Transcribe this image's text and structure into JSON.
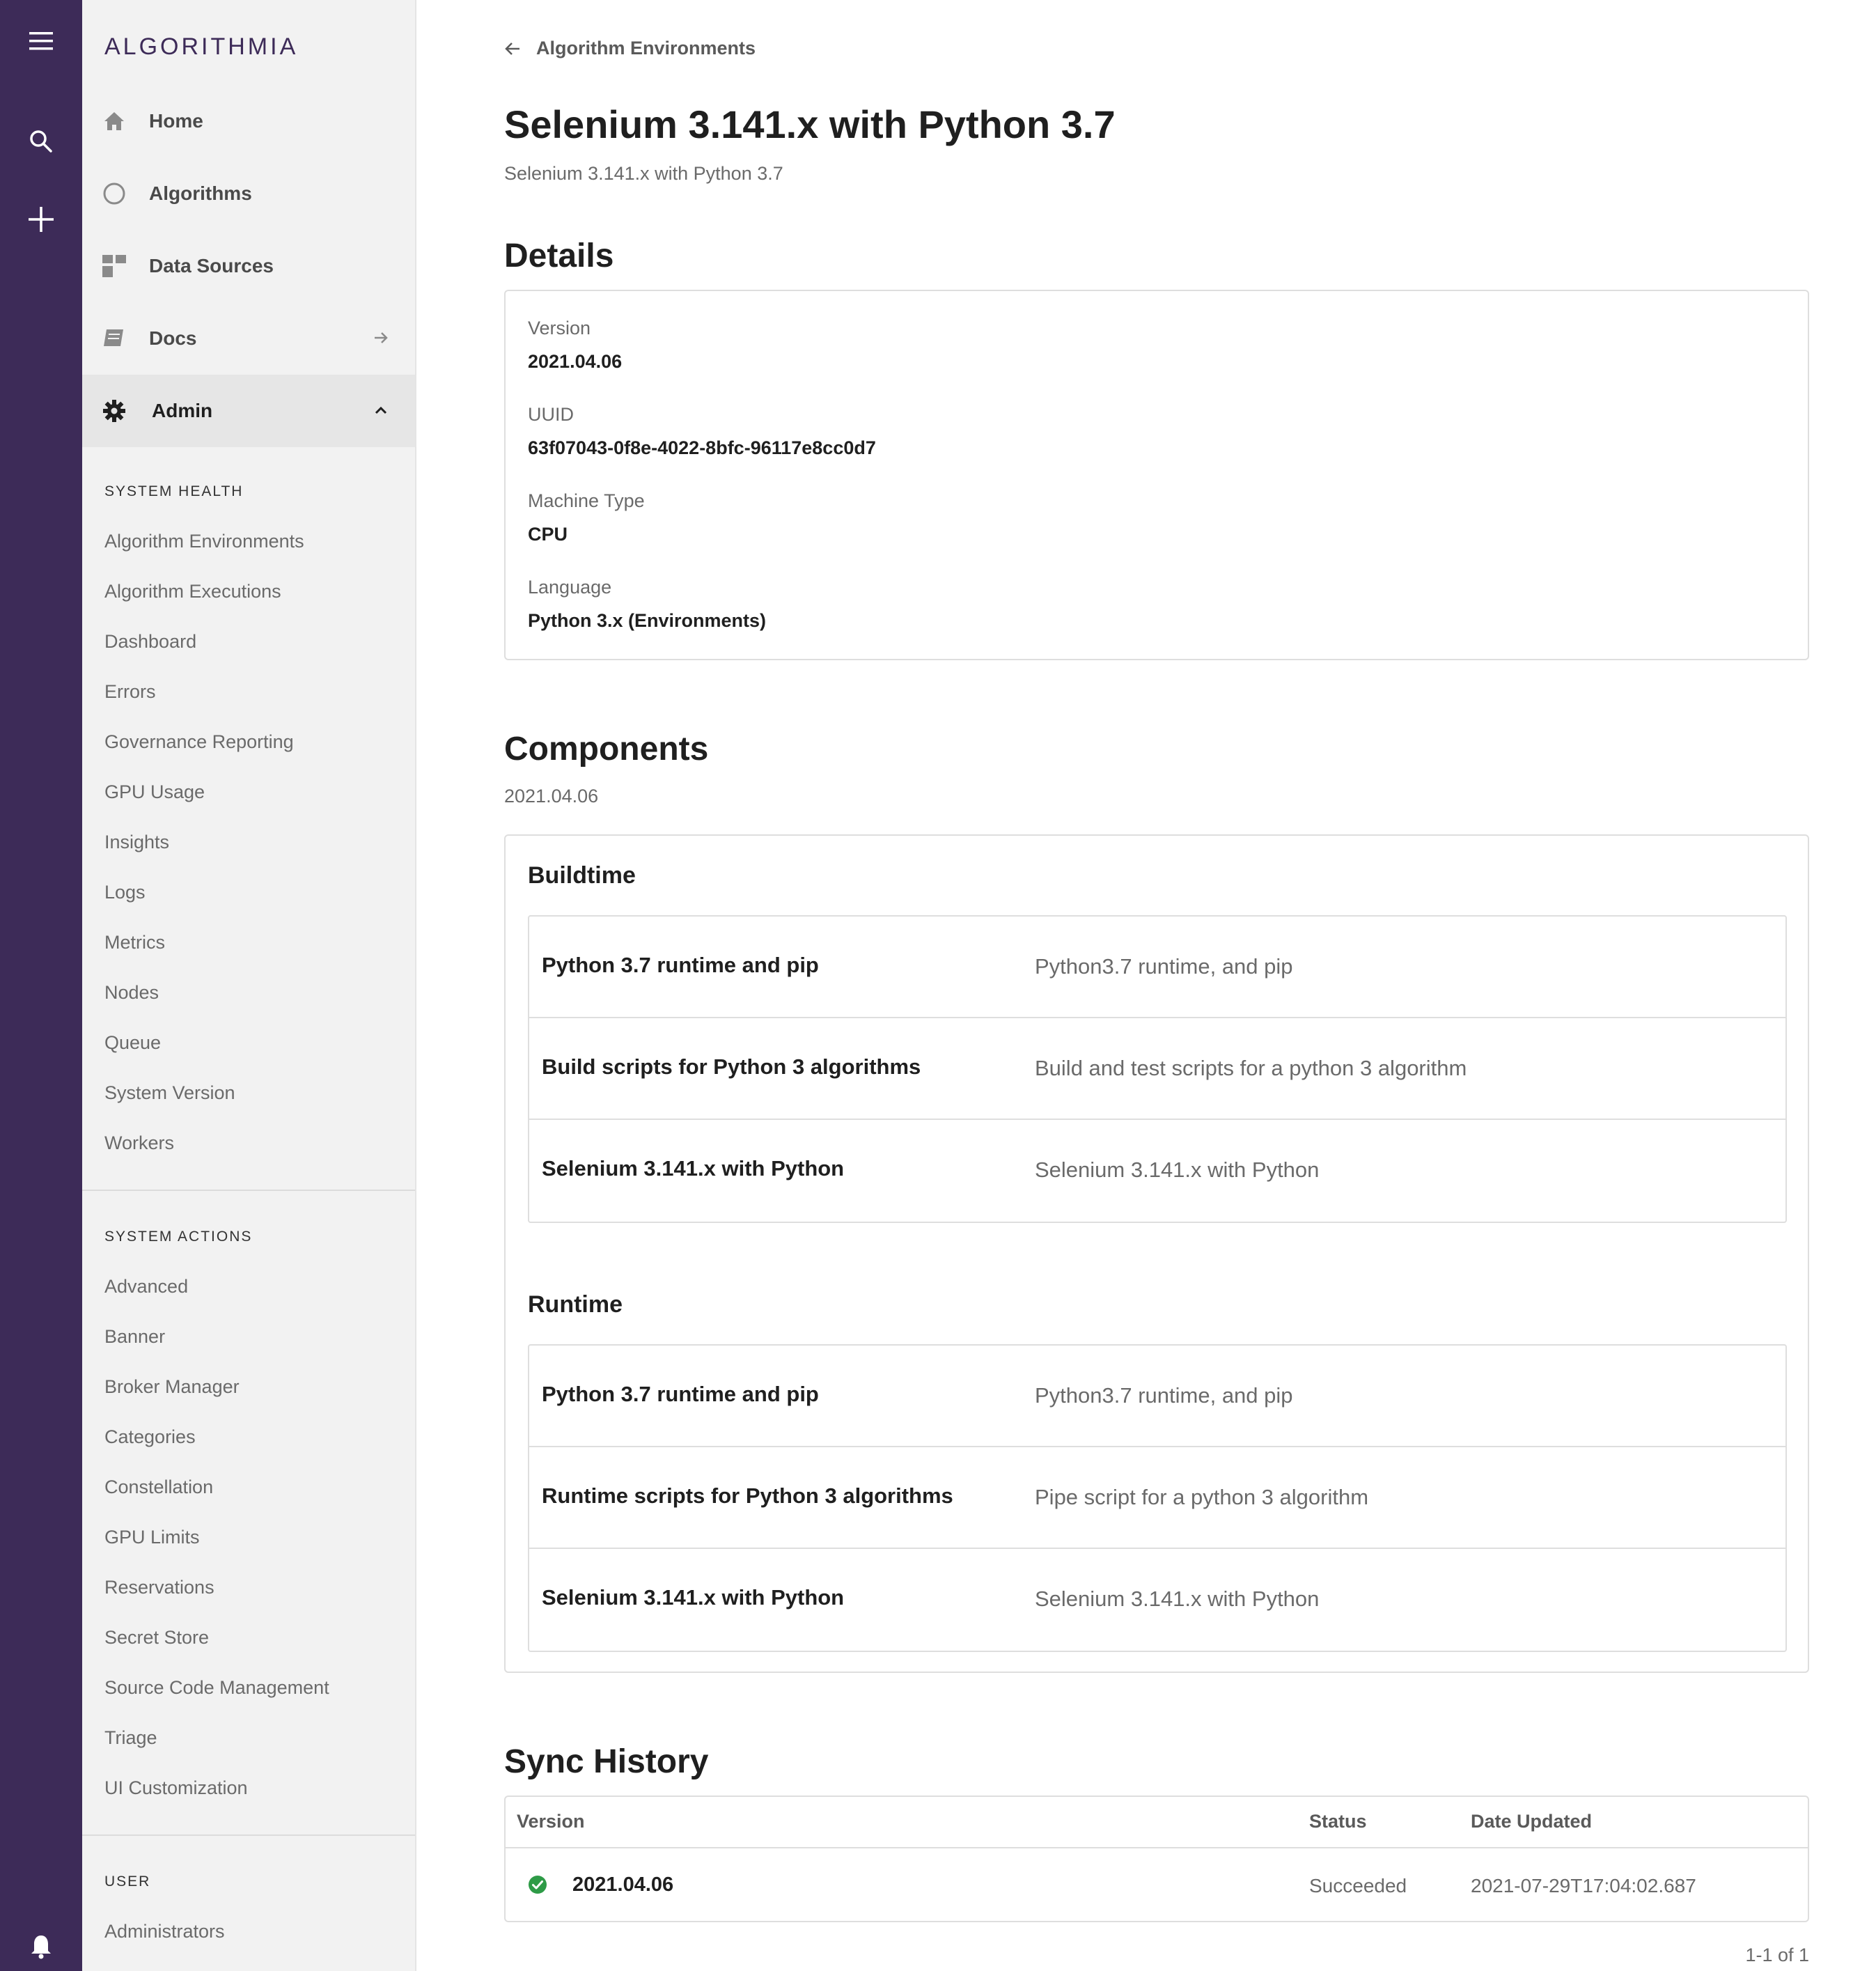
{
  "brand": {
    "logo_text": "ALGORITHMIA",
    "rail_color": "#3d2b58"
  },
  "rail": {
    "icons": [
      "menu-icon",
      "search-icon",
      "plus-icon",
      "bell-icon"
    ]
  },
  "sidebar": {
    "nav": [
      {
        "label": "Home",
        "icon": "home-icon"
      },
      {
        "label": "Algorithms",
        "icon": "circle-icon"
      },
      {
        "label": "Data Sources",
        "icon": "grid-icon"
      },
      {
        "label": "Docs",
        "icon": "book-icon"
      },
      {
        "label": "Admin",
        "icon": "gear-icon"
      }
    ],
    "system_health": {
      "heading": "SYSTEM HEALTH",
      "items": [
        "Algorithm Environments",
        "Algorithm Executions",
        "Dashboard",
        "Errors",
        "Governance Reporting",
        "GPU Usage",
        "Insights",
        "Logs",
        "Metrics",
        "Nodes",
        "Queue",
        "System Version",
        "Workers"
      ]
    },
    "system_actions": {
      "heading": "SYSTEM ACTIONS",
      "items": [
        "Advanced",
        "Banner",
        "Broker Manager",
        "Categories",
        "Constellation",
        "GPU Limits",
        "Reservations",
        "Secret Store",
        "Source Code Management",
        "Triage",
        "UI Customization"
      ]
    },
    "user": {
      "heading": "USER",
      "items": [
        "Administrators"
      ]
    }
  },
  "main": {
    "back_label": "Algorithm Environments",
    "title": "Selenium 3.141.x with Python 3.7",
    "subtitle": "Selenium 3.141.x with Python 3.7",
    "details": {
      "heading": "Details",
      "fields": [
        {
          "label": "Version",
          "value": "2021.04.06"
        },
        {
          "label": "UUID",
          "value": "63f07043-0f8e-4022-8bfc-96117e8cc0d7"
        },
        {
          "label": "Machine Type",
          "value": "CPU"
        },
        {
          "label": "Language",
          "value": "Python 3.x (Environments)"
        }
      ]
    },
    "components": {
      "heading": "Components",
      "version": "2021.04.06",
      "buildtime": {
        "title": "Buildtime",
        "rows": [
          {
            "name": "Python 3.7 runtime and pip",
            "desc": "Python3.7 runtime, and pip"
          },
          {
            "name": "Build scripts for Python 3 algorithms",
            "desc": "Build and test scripts for a python 3 algorithm"
          },
          {
            "name": "Selenium 3.141.x with Python",
            "desc": "Selenium 3.141.x with Python"
          }
        ]
      },
      "runtime": {
        "title": "Runtime",
        "rows": [
          {
            "name": "Python 3.7 runtime and pip",
            "desc": "Python3.7 runtime, and pip"
          },
          {
            "name": "Runtime scripts for Python 3 algorithms",
            "desc": "Pipe script for a python 3 algorithm"
          },
          {
            "name": "Selenium 3.141.x with Python",
            "desc": "Selenium 3.141.x with Python"
          }
        ]
      }
    },
    "sync_history": {
      "heading": "Sync History",
      "columns": {
        "version": "Version",
        "status": "Status",
        "date": "Date Updated"
      },
      "rows": [
        {
          "version": "2021.04.06",
          "status": "Succeeded",
          "date": "2021-07-29T17:04:02.687",
          "status_color": "#2e9b47"
        }
      ],
      "pager": "1-1 of 1"
    }
  }
}
